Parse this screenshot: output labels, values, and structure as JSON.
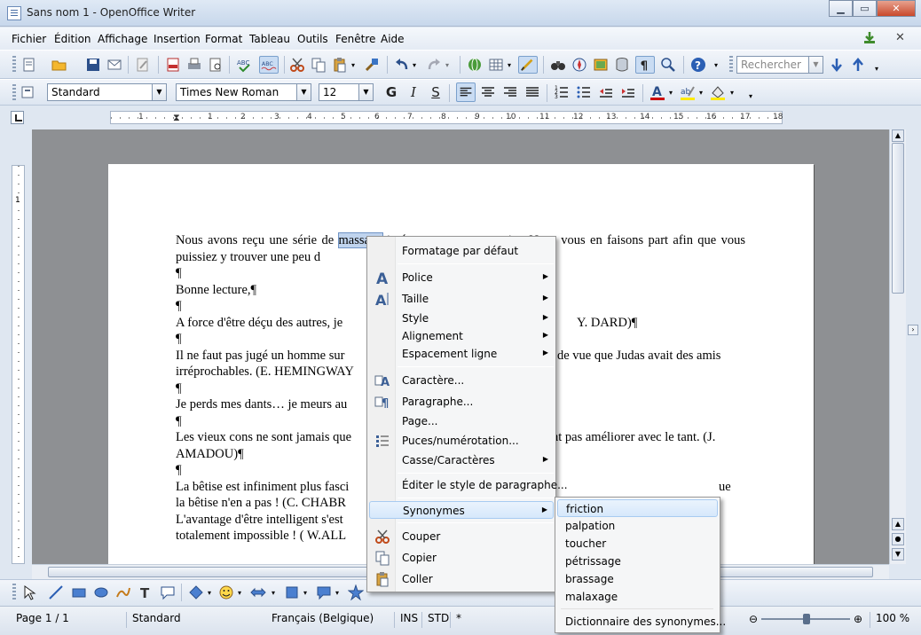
{
  "window": {
    "title": "Sans nom 1 - OpenOffice Writer"
  },
  "menu": {
    "items": [
      "Fichier",
      "Édition",
      "Affichage",
      "Insertion",
      "Format",
      "Tableau",
      "Outils",
      "Fenêtre",
      "Aide"
    ]
  },
  "toolbar": {
    "search_placeholder": "Rechercher"
  },
  "format_bar": {
    "style": "Standard",
    "font": "Times New Roman",
    "size": "12",
    "bold": "G",
    "italic": "I",
    "underline": "S"
  },
  "ruler": {
    "labels": [
      "1",
      "1",
      "2",
      "3",
      "4",
      "5",
      "6",
      "7",
      "8",
      "9",
      "10",
      "11",
      "12",
      "13",
      "14",
      "15",
      "16",
      "17",
      "18"
    ]
  },
  "document": {
    "lines": [
      {
        "pre": "Nous avons reçu une série de ",
        "sel": "massage",
        "post": " intéressants sur notre site. Nous vous en faisons part afin que vous puissiez y trouver une peu d"
      },
      {
        "text": "¶"
      },
      {
        "text": "Bonne lecture,¶"
      },
      {
        "text": "¶"
      },
      {
        "text": "A force d'être déçu des autres, je"
      },
      {
        "text": "¶"
      },
      {
        "text": "Il ne faut pas jugé un homme sur"
      },
      {
        "text": "irréprochables. (E. HEMINGWAY"
      },
      {
        "text": "¶"
      },
      {
        "text": "Je perds mes dants… je meurs au"
      },
      {
        "text": "¶"
      },
      {
        "text": "Les vieux cons ne sont jamais que"
      },
      {
        "text": "AMADOU)¶"
      },
      {
        "text": "¶"
      },
      {
        "text": "La bêtise est infiniment plus fasci"
      },
      {
        "text": "la bêtise n'en a pas ! (C. CHABR"
      },
      {
        "text": "L'avantage d'être intelligent s'est"
      },
      {
        "text": "totalement impossible ! ( W.ALL"
      }
    ],
    "line_tails": {
      "dard": "Y. DARD)¶",
      "judas": "de vue que Judas avait des amis",
      "tant": "nt pas améliorer avec le tant. (J.",
      "que": "ue"
    }
  },
  "context_menu": {
    "items": [
      {
        "label": "Formatage par défaut",
        "sub": false
      },
      {
        "label": "Police",
        "sub": true
      },
      {
        "label": "Taille",
        "sub": true
      },
      {
        "label": "Style",
        "sub": true
      },
      {
        "label": "Alignement",
        "sub": true
      },
      {
        "label": "Espacement ligne",
        "sub": true
      },
      {
        "label": "Caractère...",
        "sub": false
      },
      {
        "label": "Paragraphe...",
        "sub": false
      },
      {
        "label": "Page...",
        "sub": false
      },
      {
        "label": "Puces/numérotation...",
        "sub": false
      },
      {
        "label": "Casse/Caractères",
        "sub": true
      },
      {
        "label": "Éditer le style de paragraphe...",
        "sub": false
      },
      {
        "label": "Synonymes",
        "sub": true
      },
      {
        "label": "Couper",
        "sub": false
      },
      {
        "label": "Copier",
        "sub": false
      },
      {
        "label": "Coller",
        "sub": false
      }
    ]
  },
  "synonyms_menu": {
    "items": [
      "friction",
      "palpation",
      "toucher",
      "pétrissage",
      "brassage",
      "malaxage",
      "Dictionnaire des synonymes..."
    ]
  },
  "statusbar": {
    "page": "Page 1 / 1",
    "style": "Standard",
    "language": "Français (Belgique)",
    "insert_mode": "INS",
    "selection_mode": "STD",
    "modified": "*",
    "zoom": "100 %"
  },
  "colors": {
    "accent": "#c9dcf3",
    "selection": "#c0d4ee",
    "canvas": "#8e9093"
  }
}
